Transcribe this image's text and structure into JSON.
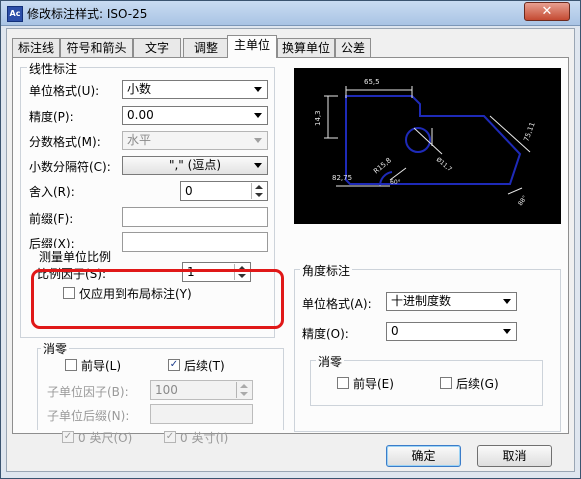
{
  "window": {
    "title": "修改标注样式: ISO-25",
    "close_glyph": "✕"
  },
  "tabs": [
    "标注线",
    "符号和箭头",
    "文字",
    "调整",
    "主单位",
    "换算单位",
    "公差"
  ],
  "active_tab": "主单位",
  "linear": {
    "title": "线性标注",
    "unit_format": {
      "label": "单位格式(U):",
      "value": "小数"
    },
    "precision": {
      "label": "精度(P):",
      "value": "0.00"
    },
    "fraction_format": {
      "label": "分数格式(M):",
      "value": "水平"
    },
    "decimal_separator": {
      "label": "小数分隔符(C):",
      "value": "\",\" (逗点)"
    },
    "round_off": {
      "label": "舍入(R):",
      "value": "0"
    },
    "prefix": {
      "label": "前缀(F):",
      "value": ""
    },
    "suffix": {
      "label": "后缀(X):",
      "value": ""
    }
  },
  "scale": {
    "title": "测量单位比例",
    "factor_label": "比例因子(S):",
    "factor_value": "1",
    "layout_only_label": "仅应用到布局标注(Y)",
    "layout_only_checked": false
  },
  "zero_suppression": {
    "title": "消零",
    "leading_label": "前导(L)",
    "leading_checked": false,
    "trailing_label": "后续(T)",
    "trailing_checked": true,
    "sub_unit_factor_label": "子单位因子(B):",
    "sub_unit_factor_value": "100",
    "sub_unit_suffix_label": "子单位后缀(N):",
    "sub_unit_suffix_value": "",
    "zero_feet_label": "0 英尺(O)",
    "zero_feet_checked": true,
    "zero_inches_label": "0 英寸(I)",
    "zero_inches_checked": true
  },
  "angular": {
    "title": "角度标注",
    "unit_format": {
      "label": "单位格式(A):",
      "value": "十进制度数"
    },
    "precision": {
      "label": "精度(O):",
      "value": "0"
    },
    "zero_title": "消零",
    "leading_label": "前导(E)",
    "leading_checked": false,
    "trailing_label": "后续(G)",
    "trailing_checked": false
  },
  "preview_labels": {
    "top_dim": "65,5",
    "left_dim": "14,3",
    "right_dim": "75,11",
    "radius": "R15,8",
    "angle": "60°",
    "diameter": "Ø11,7",
    "bottom_dim": "82,75",
    "arc": "88°"
  },
  "colors": {
    "preview_bg": "#000000",
    "preview_geometry": "#1e2ab8",
    "preview_dims": "#e8e8e8",
    "highlight": "#e01818"
  },
  "buttons": {
    "ok": "确定",
    "cancel": "取消"
  }
}
